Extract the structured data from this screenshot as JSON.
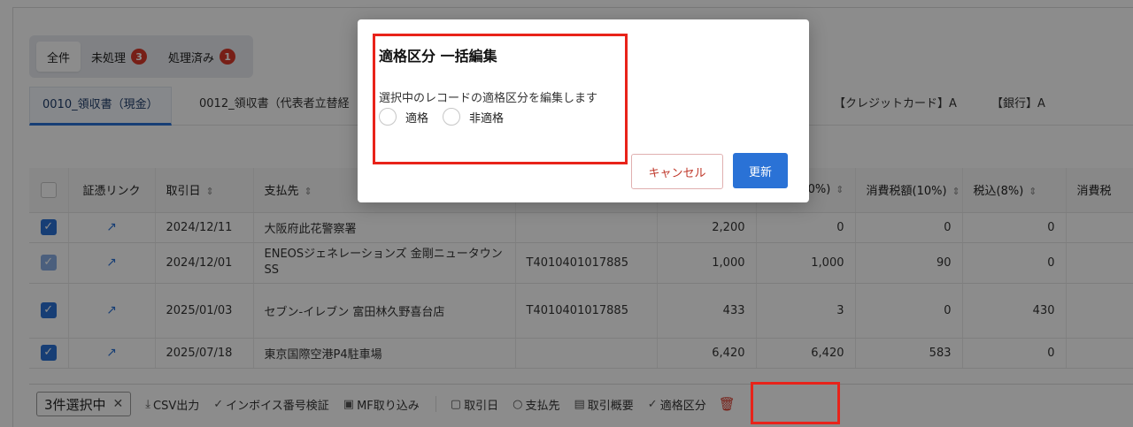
{
  "status_tabs": [
    {
      "label": "全件",
      "badge": ""
    },
    {
      "label": "未処理",
      "badge": "3"
    },
    {
      "label": "処理済み",
      "badge": "1"
    }
  ],
  "doc_tabs": [
    {
      "label": "0010_領収書（現金）"
    },
    {
      "label": "0012_領収書（代表者立替経"
    },
    {
      "label": "【クレジットカード】A"
    },
    {
      "label": "【銀行】A"
    }
  ],
  "table": {
    "headers": {
      "link": "証憑リンク",
      "date": "取引日",
      "payee": "支払先",
      "col_a": "0%)",
      "tax10": "消費税額(10%)",
      "tax8in": "税込(8%)",
      "tax8": "消費税"
    },
    "sort_glyph": "⇕",
    "rows": [
      {
        "date": "2024/12/11",
        "payee": "大阪府此花警察署",
        "invoice": "",
        "amount": "2,200",
        "col_a": "0",
        "tax10": "0",
        "tax8in": "0"
      },
      {
        "date": "2024/12/01",
        "payee": "ENEOSジェネレーションズ 金剛ニュータウンSS",
        "invoice": "T4010401017885",
        "amount": "1,000",
        "col_a": "1,000",
        "tax10": "90",
        "tax8in": "0"
      },
      {
        "date": "2025/01/03",
        "payee": "セブン-イレブン 富田林久野喜台店",
        "invoice": "T4010401017885",
        "amount": "433",
        "col_a": "3",
        "tax10": "0",
        "tax8in": "430"
      },
      {
        "date": "2025/07/18",
        "payee": "東京国際空港P4駐車場",
        "invoice": "",
        "amount": "6,420",
        "col_a": "6,420",
        "tax10": "583",
        "tax8in": "0"
      }
    ]
  },
  "action_bar": {
    "selected": "3件選択中",
    "csv": "CSV出力",
    "invoice_check": "インボイス番号検証",
    "mf_import": "MF取り込み",
    "date": "取引日",
    "payee": "支払先",
    "summary": "取引概要",
    "qualification": "適格区分"
  },
  "modal": {
    "title": "適格区分 一括編集",
    "description": "選択中のレコードの適格区分を編集します",
    "options": [
      "適格",
      "非適格"
    ],
    "cancel": "キャンセル",
    "update": "更新"
  },
  "colors": {
    "accent": "#2a72d6",
    "danger": "#d93a2b",
    "highlight": "#e8231a"
  }
}
